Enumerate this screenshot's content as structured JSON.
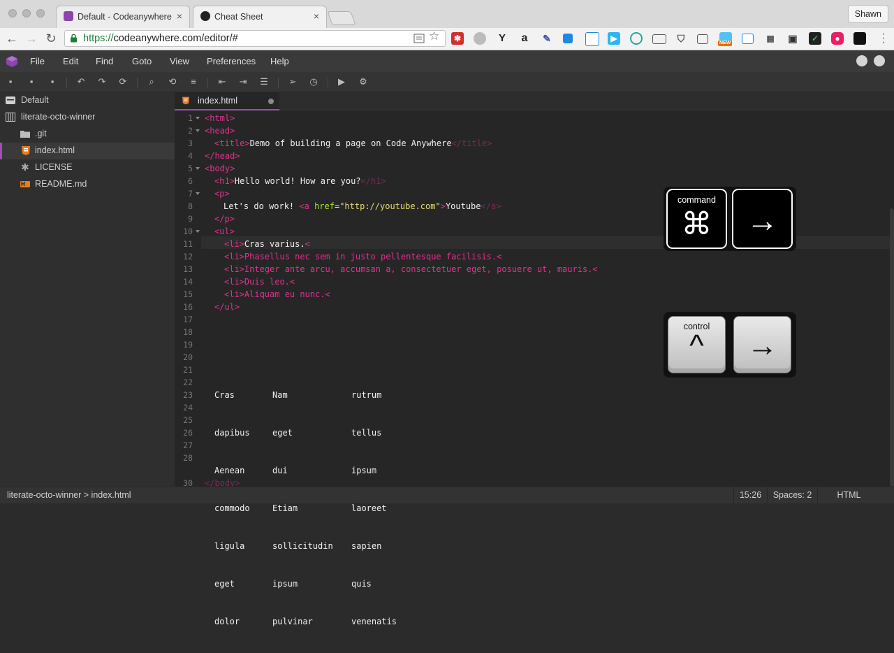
{
  "browser": {
    "tabs": [
      {
        "title": "Default - Codeanywhere",
        "close": "×",
        "active": true
      },
      {
        "title": "Cheat Sheet",
        "close": "×",
        "active": false
      }
    ],
    "user_name": "Shawn",
    "url_scheme": "https://",
    "url_rest": "codeanywhere.com/editor/#",
    "nav": {
      "back": "←",
      "forward": "→",
      "reload": "↻"
    },
    "extension_icons": [
      "bookmark-icon",
      "star-icon",
      "lastpass-icon",
      "ghost-icon",
      "y-combinator-icon",
      "amazon-icon",
      "eyedropper-icon",
      "dropbox-icon",
      "pocket-icon",
      "play-icon",
      "swirl-icon",
      "cast-icon",
      "pocket-save-icon",
      "screenshot-icon",
      "new-badge-icon",
      "window-icon",
      "grid-icon",
      "clipboard-icon",
      "checklist-icon",
      "camera-icon",
      "dark-square-icon"
    ],
    "ext_labels": {
      "y": "Y",
      "a": "a",
      "new": "NEW"
    }
  },
  "app": {
    "menu": [
      "File",
      "Edit",
      "Find",
      "Goto",
      "View",
      "Preferences",
      "Help"
    ],
    "accent": "#9d4fb5"
  },
  "sidebar": {
    "items": [
      {
        "label": "Default",
        "icon": "server-icon"
      },
      {
        "label": "literate-octo-winner",
        "icon": "repo-icon"
      },
      {
        "label": ".git",
        "icon": "folder-icon"
      },
      {
        "label": "index.html",
        "icon": "html-file-icon",
        "selected": true
      },
      {
        "label": "LICENSE",
        "icon": "asterisk-icon"
      },
      {
        "label": "README.md",
        "icon": "markdown-icon"
      }
    ]
  },
  "editor": {
    "tab": "index.html",
    "line_numbers": [
      "1",
      "2",
      "3",
      "4",
      "5",
      "6",
      "7",
      "8",
      "9",
      "10",
      "11",
      "12",
      "13",
      "14",
      "15",
      "16",
      "17",
      "18",
      "19",
      "20",
      "21",
      "22",
      "23",
      "24",
      "25",
      "26",
      "27",
      "28",
      "30"
    ],
    "code": {
      "l1": "<html>",
      "l2": "<head>",
      "l3_open": "<title>",
      "l3_text": "Demo of building a page on Code Anywhere",
      "l3_close": "</title>",
      "l4": "</head>",
      "l5": "<body>",
      "l6_open": "<h1>",
      "l6_text": "Hello world! How are you?",
      "l6_close": "</h1>",
      "l7": "<p>",
      "l8_text": "Let's do work! ",
      "l8_tag": "<a ",
      "l8_attr": "href",
      "l8_eq": "=",
      "l8_str": "\"http://youtube.com\"",
      "l8_gt": ">",
      "l8_link": "Youtube",
      "l8_close": "</a>",
      "l9": "</p>",
      "l10": "<ul>",
      "l11_open": "<li>",
      "l11_text": "Cras varius.",
      "l11_close": "<",
      "l12": "<li>Phasellus nec sem in justo pellentesque facilisis.<",
      "l13": "<li>Integer ante arcu, accumsan a, consectetuer eget, posuere ut, mauris.<",
      "l14": "<li>Duis leo.<",
      "l15": "<li>Aliquam eu nunc.<",
      "l16": "</ul>",
      "l30": "</body>"
    },
    "table": {
      "col1": [
        "Cras",
        "dapibus",
        "Aenean",
        "commodo",
        "ligula",
        "eget",
        "dolor"
      ],
      "col2": [
        "Nam",
        "eget",
        "dui",
        "Etiam",
        "sollicitudin",
        "ipsum",
        "pulvinar"
      ],
      "col3": [
        "rutrum",
        "tellus",
        "ipsum",
        "laoreet",
        "sapien",
        "quis",
        "venenatis"
      ]
    }
  },
  "overlays": {
    "mac_shortcut": {
      "modifier_label": "command",
      "modifier_symbol": "⌘",
      "arrow": "→"
    },
    "win_shortcut": {
      "modifier_label": "control",
      "modifier_symbol": "^",
      "arrow": "→"
    }
  },
  "status": {
    "breadcrumb": "literate-octo-winner > index.html",
    "cursor": "15:26",
    "indent": "Spaces: 2",
    "language": "HTML"
  }
}
